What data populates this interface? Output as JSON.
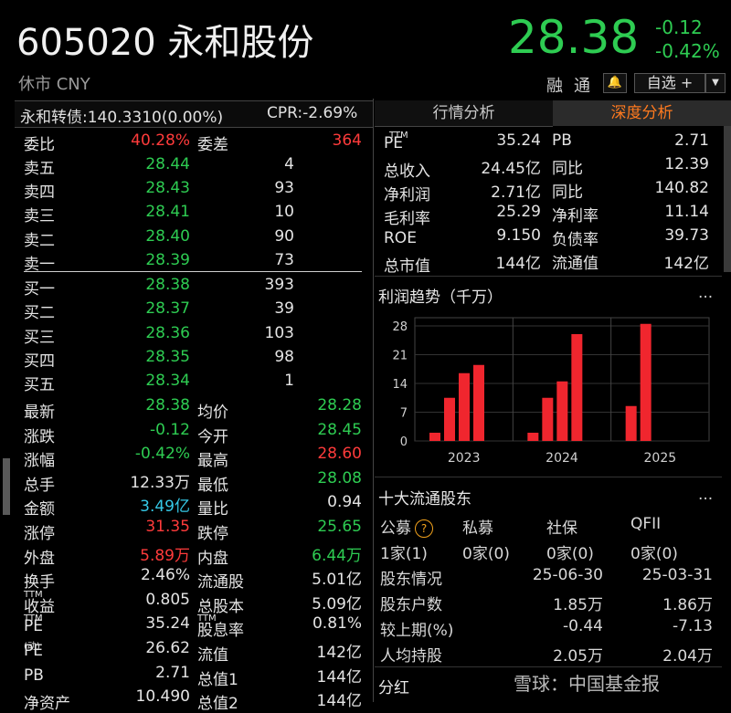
{
  "header": {
    "code_name": "605020 永和股份",
    "status": "休市 CNY",
    "price": "28.38",
    "change": "-0.12",
    "change_pct": "-0.42%",
    "rong": "融",
    "tong": "通",
    "watch_label": "自选 +"
  },
  "left_header": {
    "bond": "永和转债:140.3310(0.00%)",
    "cpr": "CPR:-2.69%"
  },
  "order_book": {
    "weibi_label": "委比",
    "weibi_value": "40.28%",
    "weicha_label": "委差",
    "weicha_value": "364",
    "asks": [
      {
        "label": "卖五",
        "price": "28.44",
        "vol": "4"
      },
      {
        "label": "卖四",
        "price": "28.43",
        "vol": "93"
      },
      {
        "label": "卖三",
        "price": "28.41",
        "vol": "10"
      },
      {
        "label": "卖二",
        "price": "28.40",
        "vol": "90"
      },
      {
        "label": "卖一",
        "price": "28.39",
        "vol": "73"
      }
    ],
    "bids": [
      {
        "label": "买一",
        "price": "28.38",
        "vol": "393"
      },
      {
        "label": "买二",
        "price": "28.37",
        "vol": "39"
      },
      {
        "label": "买三",
        "price": "28.36",
        "vol": "103"
      },
      {
        "label": "买四",
        "price": "28.35",
        "vol": "98"
      },
      {
        "label": "买五",
        "price": "28.34",
        "vol": "1"
      }
    ]
  },
  "stats": [
    {
      "l1": "最新",
      "v1": "28.38",
      "l2": "均价",
      "v2": "28.28"
    },
    {
      "l1": "涨跌",
      "v1": "-0.12",
      "l2": "今开",
      "v2": "28.45"
    },
    {
      "l1": "涨幅",
      "v1": "-0.42%",
      "l2": "最高",
      "v2": "28.60"
    },
    {
      "l1": "总手",
      "v1": "12.33万",
      "l2": "最低",
      "v2": "28.08"
    },
    {
      "l1": "金额",
      "v1": "3.49亿",
      "l2": "量比",
      "v2": "0.94"
    },
    {
      "l1": "涨停",
      "v1": "31.35",
      "l2": "跌停",
      "v2": "25.65"
    },
    {
      "l1": "外盘",
      "v1": "5.89万",
      "l2": "内盘",
      "v2": "6.44万"
    },
    {
      "l1": "换手",
      "v1": "2.46%",
      "l2": "流通股",
      "v2": "5.01亿"
    },
    {
      "l1": "收益",
      "v1": "0.805",
      "l2": "总股本",
      "v2": "5.09亿"
    },
    {
      "l1": "PE",
      "v1": "35.24",
      "l2": "股息率",
      "v2": "0.81%"
    },
    {
      "l1": "PE",
      "v1": "26.62",
      "l2": "流值",
      "v2": "142亿"
    },
    {
      "l1": "PB",
      "v1": "2.71",
      "l2": "总值1",
      "v2": "144亿"
    },
    {
      "l1": "净资产",
      "v1": "10.490",
      "l2": "总值2",
      "v2": "144亿"
    }
  ],
  "sup": {
    "ttm": "TTM",
    "dong": "(动)"
  },
  "tabs": {
    "market": "行情分析",
    "depth": "深度分析"
  },
  "fundamentals": [
    {
      "l1": "PE",
      "v1": "35.24",
      "l2": "PB",
      "v2": "2.71"
    },
    {
      "l1": "总收入",
      "v1": "24.45亿",
      "l2": "同比",
      "v2": "12.39"
    },
    {
      "l1": "净利润",
      "v1": "2.71亿",
      "l2": "同比",
      "v2": "140.82"
    },
    {
      "l1": "毛利率",
      "v1": "25.29",
      "l2": "净利率",
      "v2": "11.14"
    },
    {
      "l1": "ROE",
      "v1": "9.150",
      "l2": "负债率",
      "v2": "39.73"
    },
    {
      "l1": "总市值",
      "v1": "144亿",
      "l2": "流通值",
      "v2": "142亿"
    }
  ],
  "profit_title": "利润趋势（千万）",
  "more": "...",
  "chart_data": {
    "type": "bar",
    "title": "利润趋势（千万）",
    "x_groups": [
      "2023",
      "2024",
      "2025"
    ],
    "series": [
      {
        "values": [
          2.0,
          10.5,
          16.5,
          18.5
        ]
      },
      {
        "values": [
          2.0,
          10.5,
          14.5,
          26.0
        ]
      },
      {
        "values": [
          8.5,
          28.5
        ]
      }
    ],
    "yticks": [
      "28",
      "21",
      "14",
      "7",
      "0"
    ],
    "ylim": [
      0,
      30
    ],
    "grid": true,
    "bar_color": "#f0262e"
  },
  "holders": {
    "title": "十大流通股东",
    "cols": [
      "公募",
      "私募",
      "社保",
      "QFII"
    ],
    "vals": [
      "1家(1)",
      "0家(0)",
      "0家(0)",
      "0家(0)"
    ]
  },
  "shareholder": {
    "header": [
      "股东情况",
      "25-06-30",
      "25-03-31"
    ],
    "rows": [
      [
        "股东户数",
        "1.85万",
        "1.86万"
      ],
      [
        "较上期(%)",
        "-0.44",
        "-7.13"
      ],
      [
        "人均持股",
        "2.05万",
        "2.04万"
      ]
    ]
  },
  "dividend_title": "分红",
  "watermark": "雪球：中国基金报"
}
